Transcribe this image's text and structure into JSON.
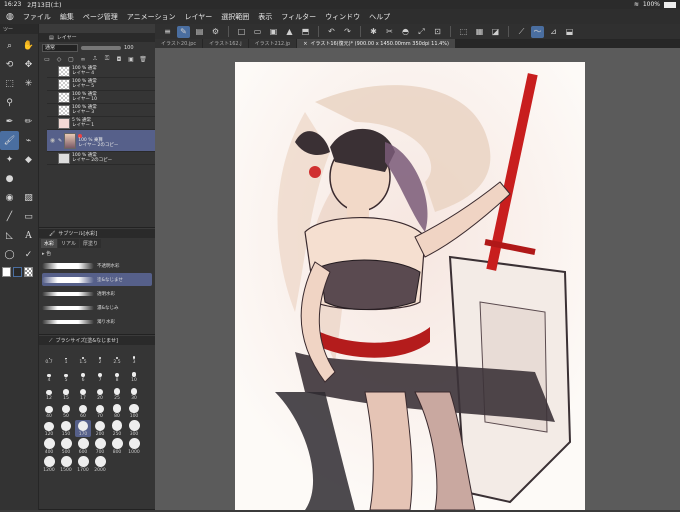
{
  "status": {
    "time": "16:23",
    "date": "2月13日(土)",
    "battery": "100%"
  },
  "menu": [
    "ファイル",
    "編集",
    "ページ管理",
    "アニメーション",
    "レイヤー",
    "選択範囲",
    "表示",
    "フィルター",
    "ウィンドウ",
    "ヘルプ"
  ],
  "tabs": [
    {
      "label": "イラスト20.jpc"
    },
    {
      "label": "イラスト162.j"
    },
    {
      "label": "イラスト212.jp"
    },
    {
      "label": "イラスト16(復元)* (900.00 x 1450.00mm 350dpi 11.4%)"
    }
  ],
  "tool_panel_title": "ツー",
  "layer_panel": {
    "title": "レイヤー",
    "blend_mode": "通常",
    "opacity": "100",
    "layers": [
      {
        "pct": "100 %  通常",
        "name": "レイヤー 4"
      },
      {
        "pct": "100 %  通常",
        "name": "レイヤー 5"
      },
      {
        "pct": "100 %  通常",
        "name": "レイヤー 10"
      },
      {
        "pct": "100 %  通常",
        "name": "レイヤー 3"
      },
      {
        "pct": "5 %  通常",
        "name": "レイヤー 1"
      },
      {
        "pct": "100 %  乗算",
        "name": "レイヤー 2のコピー"
      },
      {
        "pct": "100 %  通常",
        "name": "レイヤー 2のコピー"
      }
    ]
  },
  "subtool_panel": {
    "title": "サブツール[水彩]",
    "tabs": [
      "水彩",
      "リアル",
      "厚塗り"
    ],
    "group": "色",
    "brushes": [
      "不透明水彩",
      "塗&なじませ",
      "透明水彩",
      "濃&なじみ",
      "濁り水彩"
    ]
  },
  "brush_size_panel": {
    "title": "ブラシサイズ[塗&なじませ]",
    "sizes": [
      "0.7",
      "1",
      "1.5",
      "2",
      "2.5",
      "3",
      "4",
      "5",
      "6",
      "7",
      "8",
      "10",
      "12",
      "15",
      "17",
      "20",
      "25",
      "30",
      "40",
      "50",
      "60",
      "70",
      "80",
      "100",
      "120",
      "150",
      "170",
      "200",
      "250",
      "300",
      "400",
      "500",
      "600",
      "700",
      "800",
      "1000",
      "1200",
      "1500",
      "1700",
      "2000"
    ]
  },
  "colors": {
    "main": "#ffffff",
    "sub": "#2a2a2a",
    "accent": "#4a6ea0"
  }
}
